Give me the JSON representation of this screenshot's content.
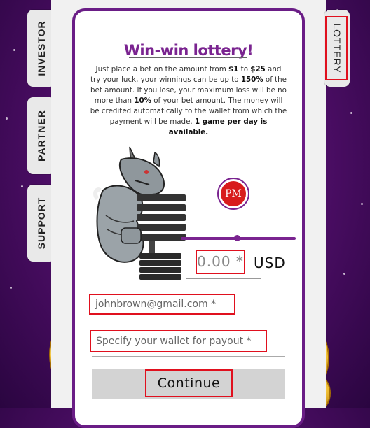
{
  "side_tabs": {
    "investor": "INVESTOR",
    "partner": "PARTNER",
    "support": "SUPPORT",
    "lottery": "LOTTERY"
  },
  "card": {
    "title": "Win-win lottery!",
    "desc": {
      "p1": "Just place a bet on the amount from ",
      "min": "$1",
      "p2": " to ",
      "max": "$25",
      "p3": " and try your luck, your winnings can be up to ",
      "win_pct": "150%",
      "p4": " of the bet amount. If you lose, your maximum loss will be no more than ",
      "loss_pct": "10%",
      "p5": " of your bet amount. The money will be credited automatically to the wallet from which the payment will be made. ",
      "limit": "1 game per day is available."
    },
    "payment_logo_text": "PM",
    "slider_value_fraction": 0.49,
    "amount_placeholder": "0.00 *",
    "currency": "USD",
    "email_value": "johnbrown@gmail.com *",
    "wallet_placeholder": "Specify your wallet for payout *",
    "continue_label": "Continue"
  },
  "colors": {
    "accent": "#7a2490",
    "highlight": "#e0101e",
    "background": "#4a0d63"
  },
  "icons": {
    "mascot": "rhino-mascot-icon",
    "payment": "perfect-money-icon",
    "coins": "gold-coin-icon"
  }
}
